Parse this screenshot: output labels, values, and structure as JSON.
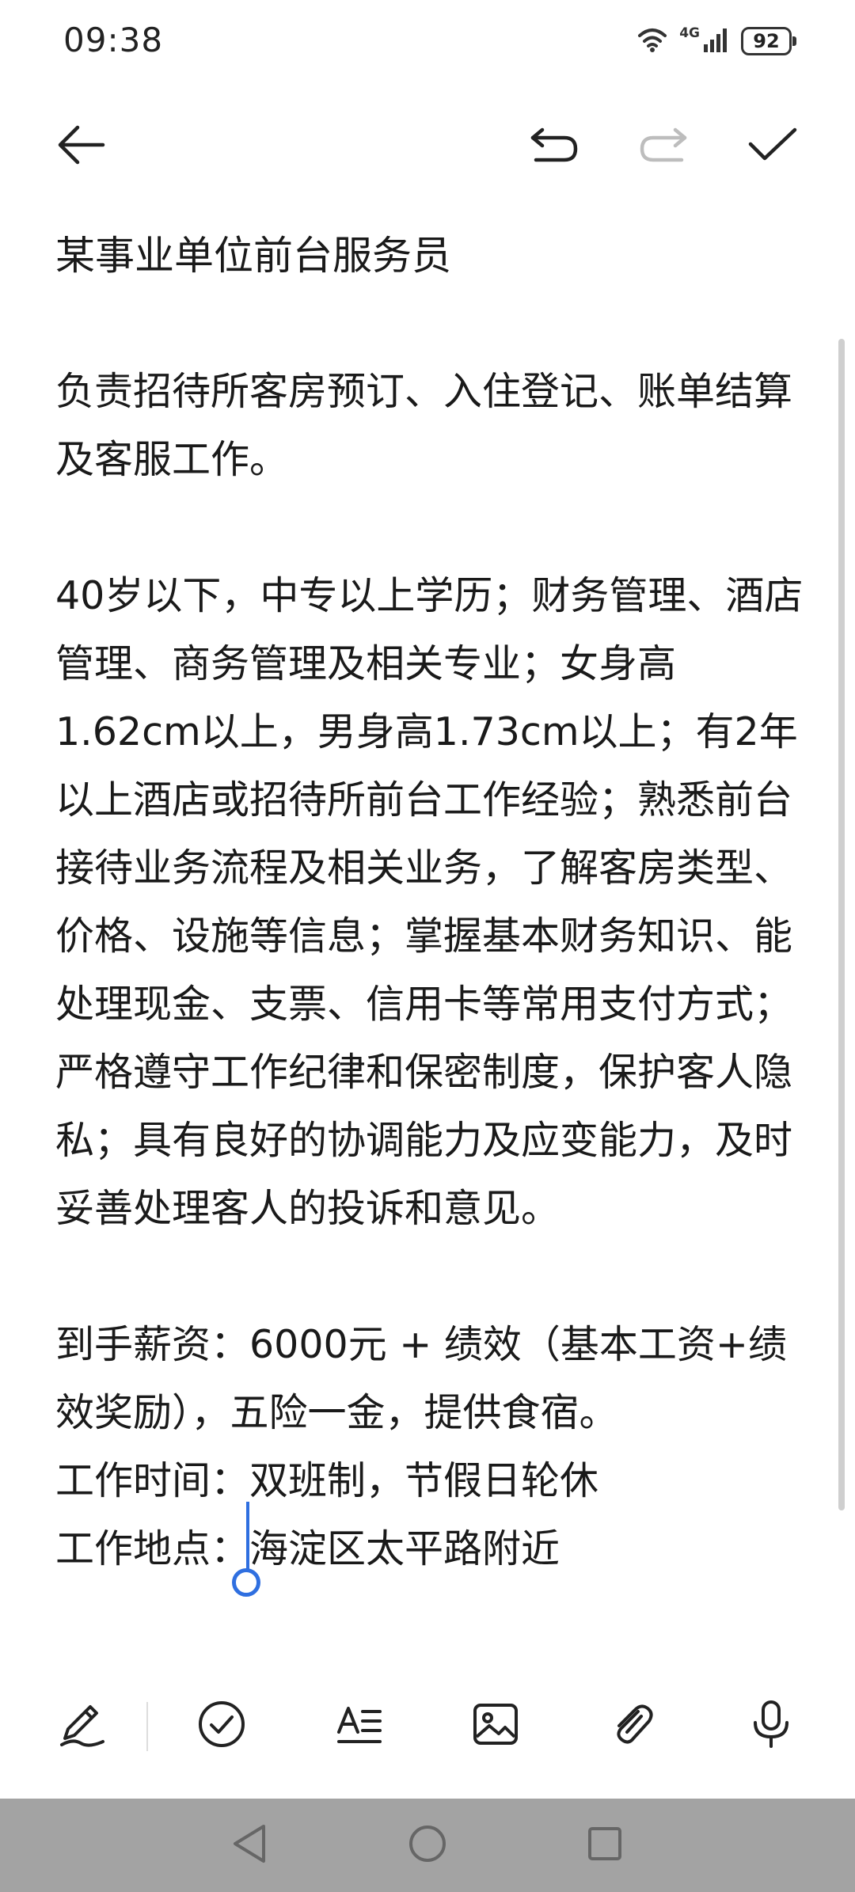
{
  "status_bar": {
    "time": "09:38",
    "network": "4G",
    "battery": "92",
    "icons": [
      "wifi-icon",
      "cellular-signal-icon",
      "battery-icon"
    ]
  },
  "toolbar": {
    "icons": [
      "back-arrow-icon",
      "undo-icon",
      "redo-icon",
      "checkmark-icon"
    ]
  },
  "note": {
    "title": "某事业单位前台服务员",
    "paragraph_1": "负责招待所客房预订、入住登记、账单结算及客服工作。",
    "paragraph_2": "40岁以下，中专以上学历；财务管理、酒店管理、商务管理及相关专业；女身高1.62cm以上，男身高1.73cm以上；有2年以上酒店或招待所前台工作经验；熟悉前台接待业务流程及相关业务，了解客房类型、价格、设施等信息；掌握基本财务知识、能处理现金、支票、信用卡等常用支付方式；严格遵守工作纪律和保密制度，保护客人隐私；具有良好的协调能力及应变能力，及时妥善处理客人的投诉和意见。",
    "salary_line": "到手薪资：6000元 + 绩效（基本工资+绩效奖励），五险一金，提供食宿。",
    "work_time_label": "工作时间：",
    "work_time_value": "双班制，节假日轮休",
    "work_place_label": "工作地点：",
    "work_place_value": "海淀区太平路附近"
  },
  "editor_toolbar": {
    "icons": [
      "handwriting-pen-icon",
      "checklist-icon",
      "text-style-icon",
      "image-icon",
      "attachment-icon",
      "microphone-icon"
    ]
  },
  "nav_bar": {
    "icons": [
      "nav-back-icon",
      "nav-home-icon",
      "nav-recents-icon"
    ]
  },
  "colors": {
    "text": "#1a1a1a",
    "cursor": "#2f6fe0",
    "disabled_icon": "#bdbdbd",
    "nav_bar_bg": "#a3a3a3"
  }
}
